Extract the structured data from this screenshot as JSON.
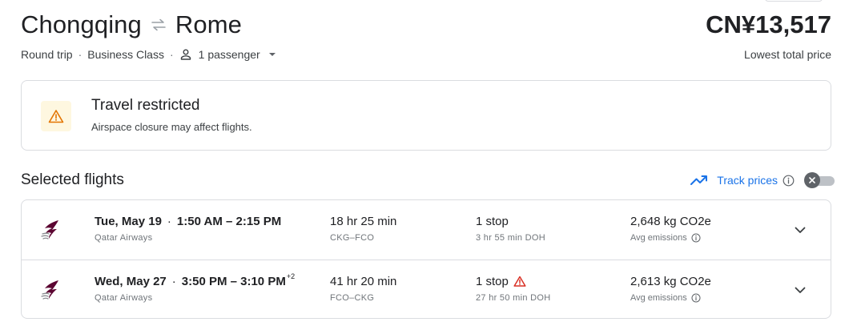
{
  "header": {
    "origin": "Chongqing",
    "destination": "Rome",
    "price": "CN¥13,517",
    "price_note": "Lowest total price",
    "trip_type": "Round trip",
    "cabin": "Business Class",
    "passengers": "1 passenger"
  },
  "alert": {
    "title": "Travel restricted",
    "message": "Airspace closure may affect flights."
  },
  "selected": {
    "title": "Selected flights",
    "track_label": "Track prices",
    "track_enabled": false
  },
  "flights": [
    {
      "date": "Tue, May 19",
      "times": "1:50 AM – 2:15 PM",
      "day_offset": "",
      "airline": "Qatar Airways",
      "duration": "18 hr 25 min",
      "route": "CKG–FCO",
      "stops": "1 stop",
      "layover": "3 hr 55 min DOH",
      "stop_warning": false,
      "emissions": "2,648 kg CO2e",
      "emissions_label": "Avg emissions"
    },
    {
      "date": "Wed, May 27",
      "times": "3:50 PM – 3:10 PM",
      "day_offset": "+2",
      "airline": "Qatar Airways",
      "duration": "41 hr 20 min",
      "route": "FCO–CKG",
      "stops": "1 stop",
      "layover": "27 hr 50 min DOH",
      "stop_warning": true,
      "emissions": "2,613 kg CO2e",
      "emissions_label": "Avg emissions"
    }
  ],
  "colors": {
    "accent": "#1a73e8",
    "warning": "#e37400",
    "error": "#d93025",
    "airline_brand": "#5c0632"
  },
  "icons": {
    "swap": "swap-arrows-icon",
    "passenger": "person-icon",
    "dropdown": "caret-down-icon",
    "alert": "warning-triangle-icon",
    "track": "trending-up-icon",
    "info": "info-icon",
    "toggle": "close-icon",
    "airline": "qatar-airways-logo-icon",
    "expand": "chevron-down-icon"
  }
}
